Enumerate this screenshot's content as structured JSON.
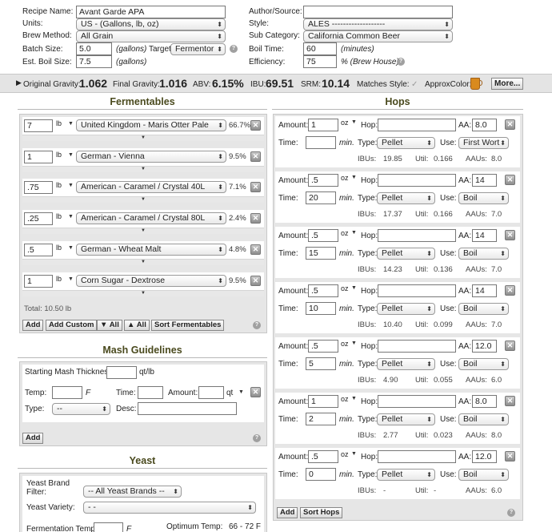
{
  "recipe": {
    "name_label": "Recipe Name:",
    "name": "Avant Garde APA",
    "units_label": "Units:",
    "units": "US - (Gallons, lb, oz)",
    "method_label": "Brew Method:",
    "method": "All Grain",
    "batch_label": "Batch Size:",
    "batch": "5.0",
    "batch_unit": "(gallons)",
    "target_label": "Target:",
    "target": "Fermentor",
    "boil_size_label": "Est. Boil Size:",
    "boil_size": "7.5",
    "boil_size_unit": "(gallons)",
    "author_label": "Author/Source:",
    "author": "",
    "style_label": "Style:",
    "style": "ALES -------------------",
    "subcat_label": "Sub Category:",
    "subcat": "California Common Beer",
    "boil_time_label": "Boil Time:",
    "boil_time": "60",
    "boil_time_unit": "(minutes)",
    "efficiency_label": "Efficiency:",
    "efficiency": "75",
    "efficiency_unit": "% (Brew House)"
  },
  "stats": {
    "og_label": "Original Gravity:",
    "og": "1.062",
    "fg_label": "Final Gravity:",
    "fg": "1.016",
    "abv_label": "ABV:",
    "abv": "6.15%",
    "ibu_label": "IBU:",
    "ibu": "69.51",
    "srm_label": "SRM:",
    "srm": "10.14",
    "matches_label": "Matches Style:",
    "approx_color_label": "ApproxColor:",
    "beer_color": "#d98a1e",
    "more_label": "More..."
  },
  "fermentables": {
    "title": "Fermentables",
    "unit": "lb",
    "items": [
      {
        "amount": "7",
        "name": "United Kingdom - Maris Otter Pale",
        "pct": "66.7%"
      },
      {
        "amount": "1",
        "name": "German - Vienna",
        "pct": "9.5%"
      },
      {
        "amount": ".75",
        "name": "American - Caramel / Crystal 40L",
        "pct": "7.1%"
      },
      {
        "amount": ".25",
        "name": "American - Caramel / Crystal 80L",
        "pct": "2.4%"
      },
      {
        "amount": ".5",
        "name": "German - Wheat Malt",
        "pct": "4.8%"
      },
      {
        "amount": "1",
        "name": "Corn Sugar - Dextrose",
        "pct": "9.5%"
      }
    ],
    "total": "Total: 10.50 lb",
    "btn_add": "Add",
    "btn_add_custom": "Add Custom",
    "btn_down_all": "▼ All",
    "btn_up_all": "▲ All",
    "btn_sort": "Sort Fermentables"
  },
  "mash": {
    "title": "Mash Guidelines",
    "thickness_label": "Starting Mash Thickness:",
    "thickness_unit": "qt/lb",
    "temp_label": "Temp:",
    "temp_unit": "F",
    "time_label": "Time:",
    "amount_label": "Amount:",
    "amount_unit": "qt",
    "type_label": "Type:",
    "type_value": "--",
    "desc_label": "Desc:",
    "btn_add": "Add"
  },
  "yeast": {
    "title": "Yeast",
    "brand_label_1": "Yeast Brand",
    "brand_label_2": "Filter:",
    "brand_value": "-- All Yeast Brands --",
    "variety_label": "Yeast Variety:",
    "variety_value": "- -",
    "ferm_temp_label": "Fermentation Temp:",
    "ferm_temp_unit": "F",
    "optimum_label": "Optimum Temp:",
    "optimum_value": "66 - 72 F"
  },
  "hops": {
    "title": "Hops",
    "amount_label": "Amount:",
    "unit": "oz",
    "hop_label": "Hop:",
    "aa_label": "AA:",
    "time_label": "Time:",
    "min_label": "min.",
    "type_label": "Type:",
    "use_label": "Use:",
    "ibus_label": "IBUs:",
    "util_label": "Util:",
    "aaus_label": "AAUs:",
    "items": [
      {
        "amount": "1",
        "aa": "8.0",
        "time": "",
        "type": "Pellet",
        "use": "First Wort",
        "ibus": "19.85",
        "util": "0.166",
        "aaus": "8.0"
      },
      {
        "amount": ".5",
        "aa": "14",
        "time": "20",
        "type": "Pellet",
        "use": "Boil",
        "ibus": "17.37",
        "util": "0.166",
        "aaus": "7.0"
      },
      {
        "amount": ".5",
        "aa": "14",
        "time": "15",
        "type": "Pellet",
        "use": "Boil",
        "ibus": "14.23",
        "util": "0.136",
        "aaus": "7.0"
      },
      {
        "amount": ".5",
        "aa": "14",
        "time": "10",
        "type": "Pellet",
        "use": "Boil",
        "ibus": "10.40",
        "util": "0.099",
        "aaus": "7.0"
      },
      {
        "amount": ".5",
        "aa": "12.0",
        "time": "5",
        "type": "Pellet",
        "use": "Boil",
        "ibus": "4.90",
        "util": "0.055",
        "aaus": "6.0"
      },
      {
        "amount": "1",
        "aa": "8.0",
        "time": "2",
        "type": "Pellet",
        "use": "Boil",
        "ibus": "2.77",
        "util": "0.023",
        "aaus": "8.0"
      },
      {
        "amount": ".5",
        "aa": "12.0",
        "time": "0",
        "type": "Pellet",
        "use": "Boil",
        "ibus": "-",
        "util": "-",
        "aaus": "6.0"
      }
    ],
    "btn_add": "Add",
    "btn_sort": "Sort Hops"
  }
}
